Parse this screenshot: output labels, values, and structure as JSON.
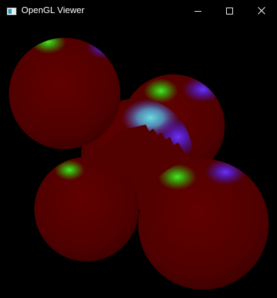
{
  "window": {
    "title": "OpenGL Viewer",
    "icon": "app-window-icon",
    "controls": {
      "minimize_icon": "minimize-icon",
      "maximize_icon": "maximize-icon",
      "close_icon": "close-icon"
    }
  },
  "scene": {
    "background_color": "#000000",
    "sphere_base_color": "#500000",
    "specular_colors": [
      "#33dd11",
      "#5522ee"
    ],
    "sphere_count": 5
  }
}
